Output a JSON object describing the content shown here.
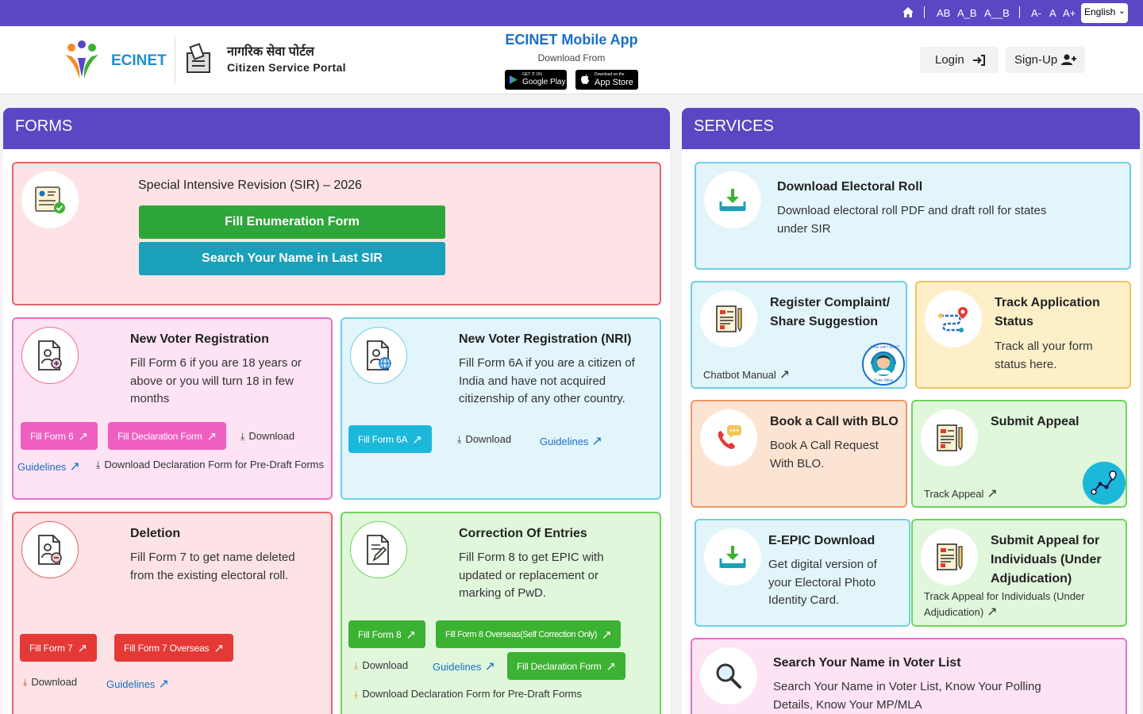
{
  "topbar": {
    "home_icon": "home-icon",
    "font_ab": "AB",
    "font_a_b": "A_B",
    "font_a__b": "A__B",
    "font_small": "A-",
    "font_normal": "A",
    "font_large": "A+",
    "language": "English"
  },
  "header": {
    "logo_text": "ECINET",
    "portal_hindi": "नागरिक सेवा पोर्टल",
    "portal_english": "Citizen Service Portal",
    "app_title": "ECINET Mobile App",
    "app_sub": "Download From",
    "google_play": "Google Play",
    "google_play_small": "GET IT ON",
    "app_store": "App Store",
    "app_store_small": "Download on the",
    "login": "Login",
    "signup": "Sign-Up"
  },
  "forms": {
    "heading": "FORMS",
    "sir": {
      "title": "Special Intensive Revision (SIR) – 2026",
      "btn_fill": "Fill Enumeration Form",
      "btn_search": "Search Your Name in Last SIR"
    },
    "new_voter": {
      "title": "New Voter Registration",
      "desc": "Fill Form 6 if you are 18 years or above or you will turn 18 in few months",
      "btn_form6": "Fill Form 6",
      "btn_decl": "Fill Declaration Form",
      "download": "Download",
      "guidelines": "Guidelines",
      "decl_download": "Download Declaration Form for Pre-Draft Forms"
    },
    "nri": {
      "title": "New Voter Registration (NRI)",
      "desc": "Fill Form 6A if you are a citizen of India and have not acquired citizenship of any other country.",
      "btn_form6a": "Fill Form 6A",
      "download": "Download",
      "guidelines": "Guidelines"
    },
    "deletion": {
      "title": "Deletion",
      "desc": "Fill Form 7 to get name deleted from the existing electoral roll.",
      "btn_form7": "Fill Form 7",
      "btn_form7o": "Fill Form 7 Overseas",
      "download": "Download",
      "guidelines": "Guidelines"
    },
    "correction": {
      "title": "Correction Of Entries",
      "desc": "Fill Form 8 to get EPIC with updated or replacement or marking of PwD.",
      "btn_form8": "Fill Form 8",
      "btn_form8o": "Fill Form 8 Overseas(Self Correction Only)",
      "download": "Download",
      "guidelines": "Guidelines",
      "btn_decl": "Fill Declaration Form",
      "decl_download": "Download Declaration Form for Pre-Draft Forms"
    }
  },
  "services": {
    "heading": "SERVICES",
    "electoral_roll": {
      "title": "Download Electoral Roll",
      "desc": "Download electoral roll PDF and draft roll for states under SIR"
    },
    "complaint": {
      "title": "Register Complaint/ Share Suggestion",
      "link": "Chatbot Manual",
      "badge_top": "How can I help?",
      "badge_bottom": "Voter Mitra"
    },
    "track": {
      "title": "Track Application Status",
      "desc": "Track all your form status here."
    },
    "blo": {
      "title": "Book a Call with BLO",
      "desc": "Book A Call Request With BLO."
    },
    "appeal": {
      "title": "Submit Appeal",
      "link": "Track Appeal"
    },
    "epic": {
      "title": "E-EPIC Download",
      "desc": "Get digital version of your Electoral Photo Identity Card."
    },
    "appeal_ind": {
      "title": "Submit Appeal for Individuals (Under Adjudication)",
      "link": "Track Appeal for Individuals (Under Adjudication)"
    },
    "search": {
      "title": "Search Your Name in Voter List",
      "desc": "Search Your Name in Voter List, Know Your Polling Details, Know Your MP/MLA"
    }
  },
  "colors": {
    "brand": "#5b47c4",
    "green_btn": "#2fa63b",
    "teal_btn": "#1aa0b8",
    "pink_btn": "#ef5fc2",
    "red_btn": "#e53935",
    "green_small": "#3cb232",
    "cyan_btn": "#1cb8da"
  }
}
